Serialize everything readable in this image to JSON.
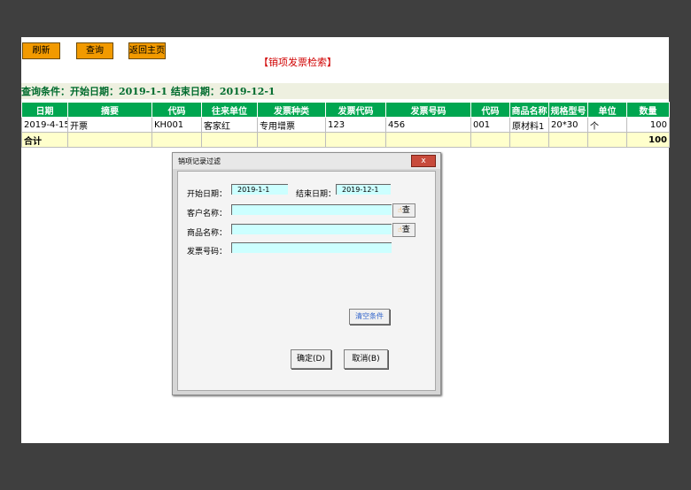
{
  "toolbar": {
    "refresh": "刷新",
    "query": "查询",
    "home": "返回主页"
  },
  "page_title": "【销项发票检索】",
  "condition_text": "查询条件：开始日期：2019-1-1 结束日期：2019-12-1",
  "table": {
    "headers": [
      "日期",
      "摘要",
      "代码",
      "往来单位",
      "发票种类",
      "发票代码",
      "发票号码",
      "代码",
      "商品名称",
      "规格型号",
      "单位",
      "数量"
    ],
    "rows": [
      [
        "2019-4-15",
        "开票",
        "KH001",
        "客家红",
        "专用增票",
        "123",
        "456",
        "001",
        "原材料1",
        "20*30",
        "个",
        "100"
      ]
    ],
    "total_label": "合计",
    "total_qty": "100"
  },
  "dialog": {
    "title": "销项记录过滤",
    "close": "x",
    "start_label": "开始日期：",
    "start_value": "2019-1-1",
    "end_label": "结束日期：",
    "end_value": "2019-12-1",
    "customer_label": "客户名称：",
    "customer_value": "",
    "product_label": "商品名称：",
    "product_value": "",
    "invoice_label": "发票号码：",
    "invoice_value": "",
    "lookup": "查",
    "clear": "清空条件",
    "ok": "确定(D)",
    "cancel": "取消(B)"
  }
}
